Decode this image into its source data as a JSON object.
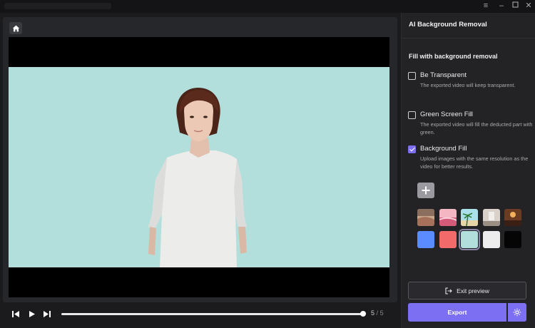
{
  "window": {
    "controls": {
      "menu_icon": "menu-icon",
      "minimize_icon": "minimize-icon",
      "maximize_icon": "maximize-icon",
      "close_icon": "close-icon"
    }
  },
  "preview": {
    "home_icon": "home-icon",
    "playback": {
      "current_frame": "5",
      "separator": "/",
      "total_frames": "5",
      "progress": 1.0
    }
  },
  "panel": {
    "title": "AI Background Removal",
    "section_title": "Fill with background removal",
    "options": [
      {
        "label": "Be Transparent",
        "description": "The exported video will keep transparent.",
        "checked": false
      },
      {
        "label": "Green Screen Fill",
        "description": "The exported video will fill the deducted part with green.",
        "checked": false
      },
      {
        "label": "Background Fill",
        "description": "Upload images with the same resolution as the video for better results.",
        "checked": true
      }
    ],
    "swatches": {
      "images": [
        "desert-image",
        "pink-sky-image",
        "palm-beach-image",
        "room-image",
        "warm-interior-image"
      ],
      "colors": [
        "#5b8cff",
        "#f26a6a",
        "#b2dfdb",
        "#ededed",
        "#050505"
      ],
      "selected_color": "#b2dfdb"
    },
    "exit_preview_label": "Exit preview",
    "export_label": "Export"
  },
  "colors": {
    "accent": "#7d6ff2",
    "background_fill": "#b2dfdb"
  }
}
